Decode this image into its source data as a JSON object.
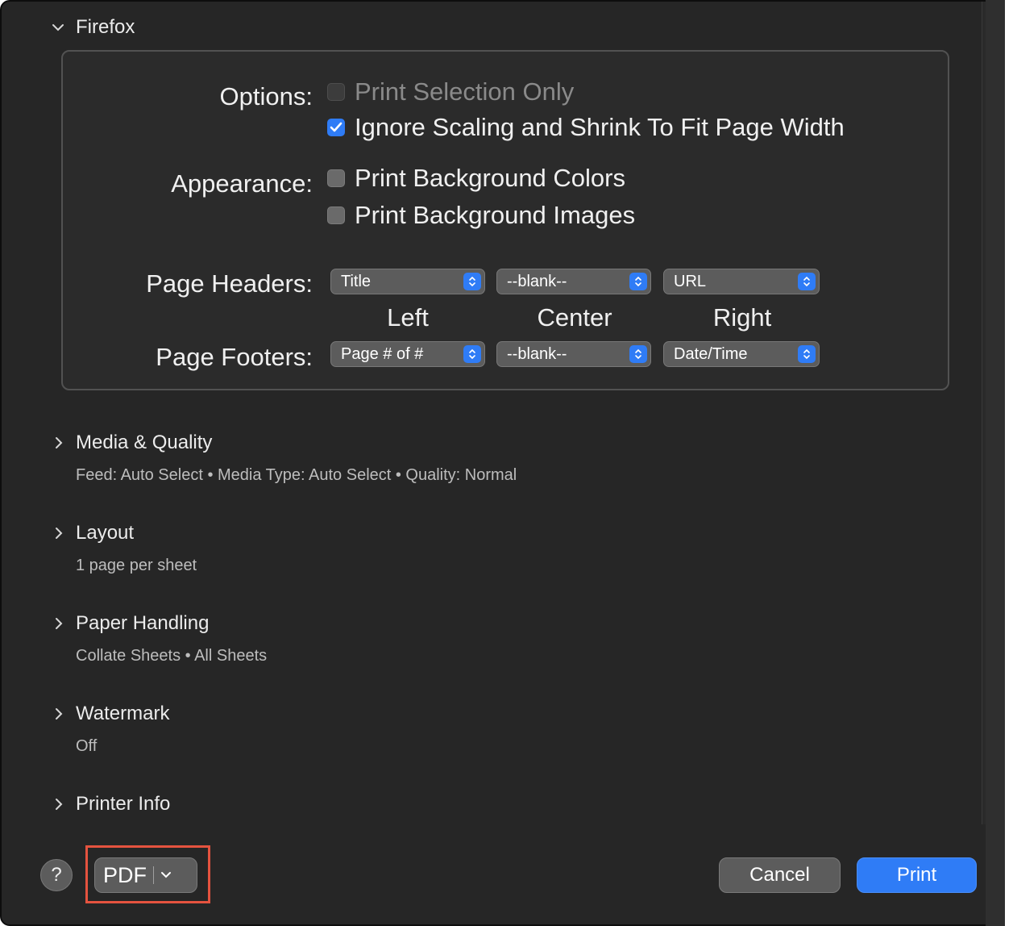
{
  "firefox_section": {
    "title": "Firefox",
    "options": {
      "label": "Options:",
      "print_selection_only": {
        "label": "Print Selection Only",
        "checked": false,
        "enabled": false
      },
      "ignore_scaling": {
        "label": "Ignore Scaling and Shrink To Fit Page Width",
        "checked": true,
        "enabled": true
      }
    },
    "appearance": {
      "label": "Appearance:",
      "bg_colors": {
        "label": "Print Background Colors",
        "checked": false
      },
      "bg_images": {
        "label": "Print Background Images",
        "checked": false
      }
    },
    "page_headers": {
      "label": "Page Headers:",
      "left": "Title",
      "center": "--blank--",
      "right": "URL"
    },
    "columns": {
      "left": "Left",
      "center": "Center",
      "right": "Right"
    },
    "page_footers": {
      "label": "Page Footers:",
      "left": "Page # of #",
      "center": "--blank--",
      "right": "Date/Time"
    }
  },
  "sections": [
    {
      "title": "Media & Quality",
      "summary": "Feed: Auto Select • Media Type: Auto Select • Quality: Normal"
    },
    {
      "title": "Layout",
      "summary": "1 page per sheet"
    },
    {
      "title": "Paper Handling",
      "summary": "Collate Sheets • All Sheets"
    },
    {
      "title": "Watermark",
      "summary": "Off"
    },
    {
      "title": "Printer Info",
      "summary": ""
    }
  ],
  "bottom_bar": {
    "help": "?",
    "pdf": "PDF",
    "cancel": "Cancel",
    "print": "Print"
  },
  "colors": {
    "background": "#262626",
    "accent": "#2f7cf6",
    "highlight": "#e5533f"
  }
}
